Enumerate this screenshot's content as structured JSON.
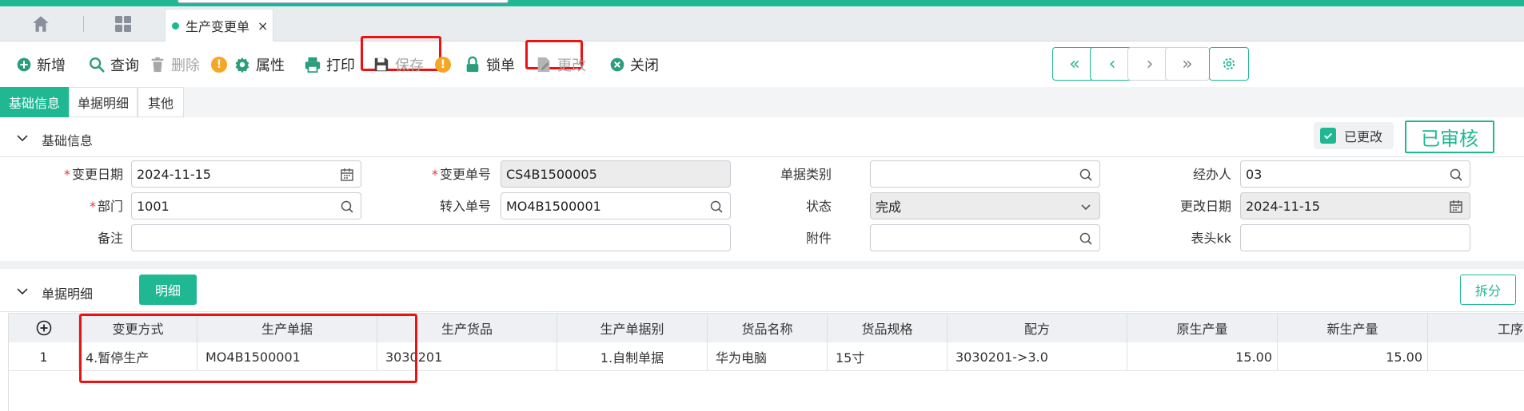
{
  "tabstrip": {
    "active_tab": "生产变更单",
    "close_glyph": "×"
  },
  "toolbar": {
    "add": "新增",
    "query": "查询",
    "delete": "删除",
    "warn_glyph": "!",
    "properties": "属性",
    "print": "打印",
    "save": "保存",
    "lock": "锁单",
    "change": "更改",
    "close": "关闭",
    "nav_first": "«",
    "nav_prev": "‹",
    "nav_next": "›",
    "nav_last": "»"
  },
  "subtabs": [
    "基础信息",
    "单据明细",
    "其他"
  ],
  "basic": {
    "section_title": "基础信息",
    "changed_label": "已更改",
    "approved_stamp": "已审核",
    "fields": {
      "change_date": {
        "label": "变更日期",
        "value": "2024-11-15"
      },
      "change_no": {
        "label": "变更单号",
        "value": "CS4B1500005"
      },
      "doc_type": {
        "label": "单据类别",
        "value": ""
      },
      "handler": {
        "label": "经办人",
        "value": "03"
      },
      "dept": {
        "label": "部门",
        "value": "1001"
      },
      "transfer_no": {
        "label": "转入单号",
        "value": "MO4B1500001"
      },
      "status": {
        "label": "状态",
        "value": "完成"
      },
      "modify_date": {
        "label": "更改日期",
        "value": "2024-11-15"
      },
      "remark": {
        "label": "备注",
        "value": ""
      },
      "attachment": {
        "label": "附件",
        "value": ""
      },
      "header_kk": {
        "label": "表头kk",
        "value": ""
      }
    },
    "required_mark": "*"
  },
  "detail": {
    "section_title": "单据明细",
    "detail_button": "明细",
    "split_button": "拆分",
    "add_row_glyph": "+",
    "columns": [
      "变更方式",
      "生产单据",
      "生产货品",
      "生产单据别",
      "货品名称",
      "货品规格",
      "配方",
      "原生产量",
      "新生产量",
      "工序"
    ],
    "rows": [
      {
        "index": "1",
        "change_mode": "4.暂停生产",
        "prod_doc": "MO4B1500001",
        "prod_goods": "3030201",
        "doc_kind": "1.自制单据",
        "goods_name": "华为电脑",
        "goods_spec": "15寸",
        "formula": "3030201->3.0",
        "orig_qty": "15.00",
        "new_qty": "15.00",
        "process": ""
      }
    ]
  },
  "colors": {
    "accent": "#1fb893",
    "highlight": "#e11111",
    "warning": "#f5a623"
  }
}
